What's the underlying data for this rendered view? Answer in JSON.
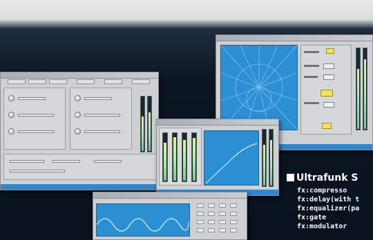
{
  "product": {
    "heading": "Ultrafunk S",
    "features": [
      "fx:compresso",
      "fx:delay(with t",
      "fx:equalizer(pa",
      "fx:gate",
      "fx:modulator"
    ]
  },
  "colors": {
    "panel": "#cfd0d4",
    "display_blue": "#2b8fd2",
    "status_blue": "#2f86cd",
    "knob_yellow": "#f0e25c",
    "background_dark": "#0c1522"
  },
  "icons": [
    "heading-square-bullet-icon"
  ]
}
